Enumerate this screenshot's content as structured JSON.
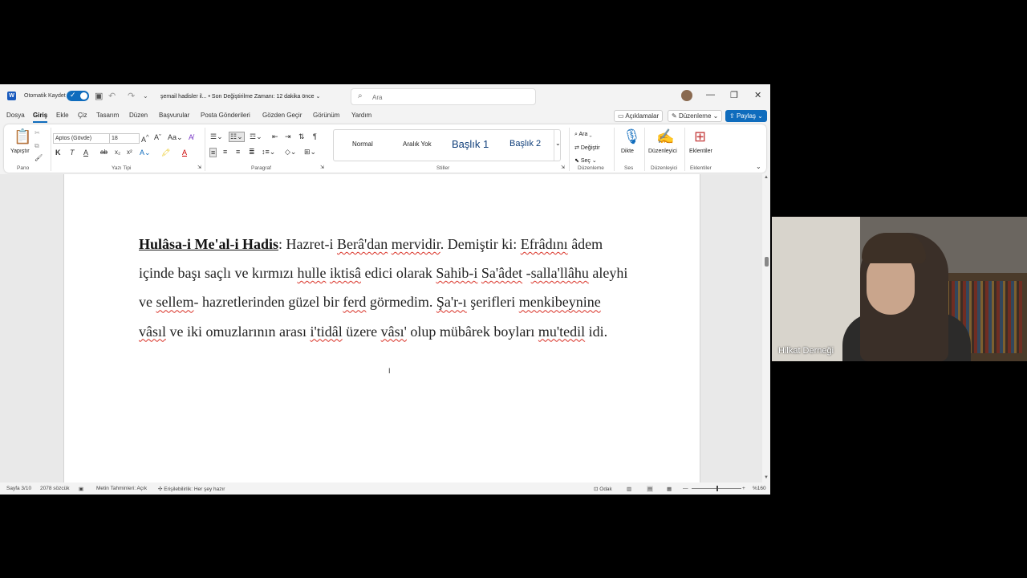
{
  "titlebar": {
    "autosave_label": "Otomatik Kaydet",
    "doc_title": "şemail hadisler il... • Son Değiştirilme Zamanı: 12 dakika önce ⌄",
    "search_placeholder": "Ara"
  },
  "tabs": [
    "Dosya",
    "Giriş",
    "Ekle",
    "Çiz",
    "Tasarım",
    "Düzen",
    "Başvurular",
    "Posta Gönderileri",
    "Gözden Geçir",
    "Görünüm",
    "Yardım"
  ],
  "top_buttons": {
    "comments": "Açıklamalar",
    "editing": "Düzenleme ⌄",
    "share": "Paylaş ⌄"
  },
  "ribbon": {
    "paste": "Yapıştır",
    "font_name": "Aptos (Gövde)",
    "font_size": "18",
    "groups": {
      "clipboard": "Pano",
      "font": "Yazı Tipi",
      "paragraph": "Paragraf",
      "styles": "Stiller",
      "editing": "Düzenleme",
      "voice": "Ses",
      "editor": "Düzenleyici",
      "addins": "Eklentiler"
    },
    "styles": [
      "Normal",
      "Aralık Yok",
      "Başlık 1",
      "Başlık 2"
    ],
    "find": "Ara",
    "replace": "Değiştir",
    "select": "Seç",
    "dictate": "Dikte",
    "editor_btn": "Düzenleyici",
    "addins_btn": "Eklentiler"
  },
  "document": {
    "heading": "Hulâsa-i Me'al-i Hadis",
    "body": {
      "t1": ": Hazret-i ",
      "w1": "Berâ'dan",
      "t2": " ",
      "w2": "mervidir",
      "t3": ". Demiştir ki: ",
      "w3": "Efrâdını",
      "t4": " âdem içinde başı saçlı ve kırmızı ",
      "w4": "hulle",
      "t5": " ",
      "w5": "iktisâ",
      "t6": " edici olarak ",
      "w6": "Sahib-i",
      "t7": " ",
      "w7": "Sa'âdet",
      "t8": " -",
      "w8": "salla'llâhu",
      "t9": " aleyhi ve ",
      "w9": "sellem",
      "t10": "- hazretlerinden güzel bir ",
      "w10": "ferd",
      "t11": " görmedim. ",
      "w11": "Şa'r-ı",
      "t12": " şerifleri ",
      "w12": "menkibeynine",
      "t13": " ",
      "w13": "vâsıl",
      "t14": " ve iki omuzlarının arası ",
      "w14": "i'tidâl",
      "t15": " üzere ",
      "w15": "vâsı'",
      "t16": " olup mübârek boyları ",
      "w16": "mu'tedil",
      "t17": " idi."
    }
  },
  "status": {
    "page": "Sayfa 3/10",
    "words": "2078 sözcük",
    "predictions": "Metin Tahminleri: Açık",
    "accessibility": "Erişilebilirlik: Her şey hazır",
    "focus": "Odak",
    "zoom": "%160"
  },
  "video": {
    "participant_name": "Hilkat Derneği"
  }
}
